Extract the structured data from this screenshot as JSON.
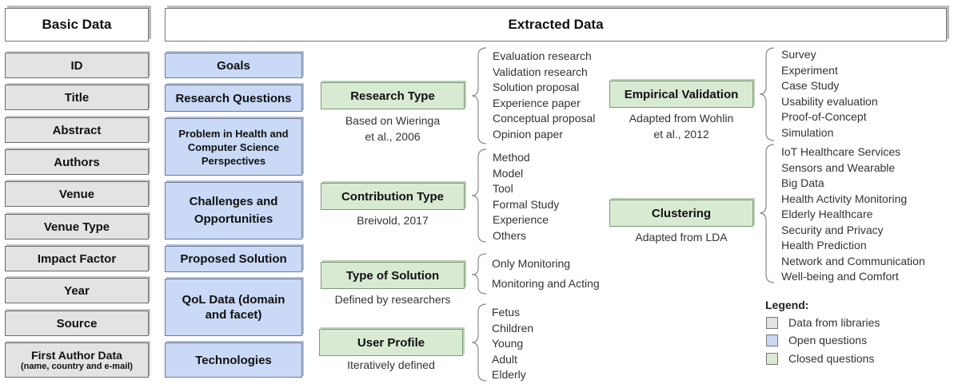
{
  "headers": {
    "basic": "Basic Data",
    "extracted": "Extracted Data"
  },
  "basic_data": [
    "ID",
    "Title",
    "Abstract",
    "Authors",
    "Venue",
    "Venue Type",
    "Impact Factor",
    "Year",
    "Source"
  ],
  "first_author": {
    "main": "First Author Data",
    "sub": "(name, country and e-mail)"
  },
  "open_questions": [
    "Goals",
    "Research Questions",
    "Problem in Health and Computer Science Perspectives",
    "Challenges and Opportunities",
    "Proposed Solution",
    "QoL Data (domain and facet)",
    "Technologies"
  ],
  "research_type": {
    "label": "Research Type",
    "note_1": "Based on Wieringa",
    "note_2": "et al., 2006",
    "items": [
      "Evaluation research",
      "Validation research",
      "Solution proposal",
      "Experience paper",
      "Conceptual proposal",
      "Opinion paper"
    ]
  },
  "contribution_type": {
    "label": "Contribution Type",
    "note": "Breivold, 2017",
    "items": [
      "Method",
      "Model",
      "Tool",
      "Formal Study",
      "Experience",
      "Others"
    ]
  },
  "type_of_solution": {
    "label": "Type of Solution",
    "note": "Defined by researchers",
    "items": [
      "Only Monitoring",
      "Monitoring and Acting"
    ]
  },
  "user_profile": {
    "label": "User Profile",
    "note": "Iteratively defined",
    "items": [
      "Fetus",
      "Children",
      "Young",
      "Adult",
      "Elderly"
    ]
  },
  "empirical_validation": {
    "label": "Empirical Validation",
    "note_1": "Adapted from Wohlin",
    "note_2": "et al., 2012",
    "items": [
      "Survey",
      "Experiment",
      "Case Study",
      "Usability evaluation",
      "Proof-of-Concept",
      "Simulation"
    ]
  },
  "clustering": {
    "label": "Clustering",
    "note": "Adapted from LDA",
    "items": [
      "IoT Healthcare Services",
      "Sensors and Wearable",
      "Big Data",
      "Health Activity Monitoring",
      "Elderly Healthcare",
      "Security and Privacy",
      "Health Prediction",
      "Network and Communication",
      "Well-being and Comfort"
    ]
  },
  "legend": {
    "title": "Legend:",
    "items": [
      {
        "label": "Data from libraries",
        "color": "#e3e3e3"
      },
      {
        "label": "Open questions",
        "color": "#c9d9f6"
      },
      {
        "label": "Closed questions",
        "color": "#d9ead3"
      }
    ]
  }
}
